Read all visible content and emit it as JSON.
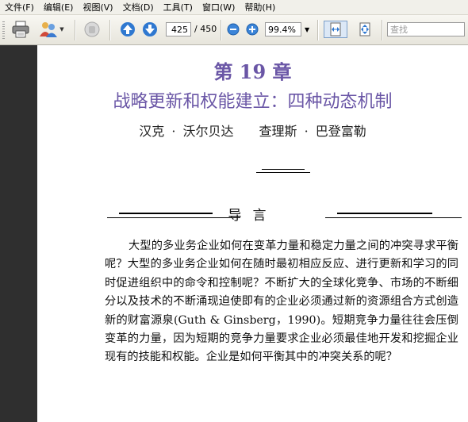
{
  "menu": [
    "文件(F)",
    "编辑(E)",
    "视图(V)",
    "文档(D)",
    "工具(T)",
    "窗口(W)",
    "帮助(H)"
  ],
  "toolbar": {
    "current_page": "425",
    "page_total": "/ 450",
    "zoom": "99.4%",
    "search_placeholder": "查找"
  },
  "document": {
    "chapter": "第 19 章",
    "title": "战略更新和权能建立：四种动态机制",
    "authors": "汉克 · 沃尔贝达　　查理斯 · 巴登富勒",
    "section_heading": "导言",
    "paragraph": "大型的多业务企业如何在变革力量和稳定力量之间的冲突寻求平衡呢？大型的多业务企业如何在随时最初相应反应、进行更新和学习的同时促进组织中的命令和控制呢？不断扩大的全球化竞争、市场的不断细分以及技术的不断涌现迫使即有的企业必须通过新的资源组合方式创造新的财富源泉(Guth & Ginsberg，1990)。短期竞争力量往往会压倒变革的力量，因为短期的竞争力量要求企业必须最佳地开发和挖掘企业现有的技能和权能。企业是如何平衡其中的冲突关系的呢？"
  },
  "colors": {
    "heading": "#6a56a6",
    "left_pane": "#2f2f2f"
  }
}
